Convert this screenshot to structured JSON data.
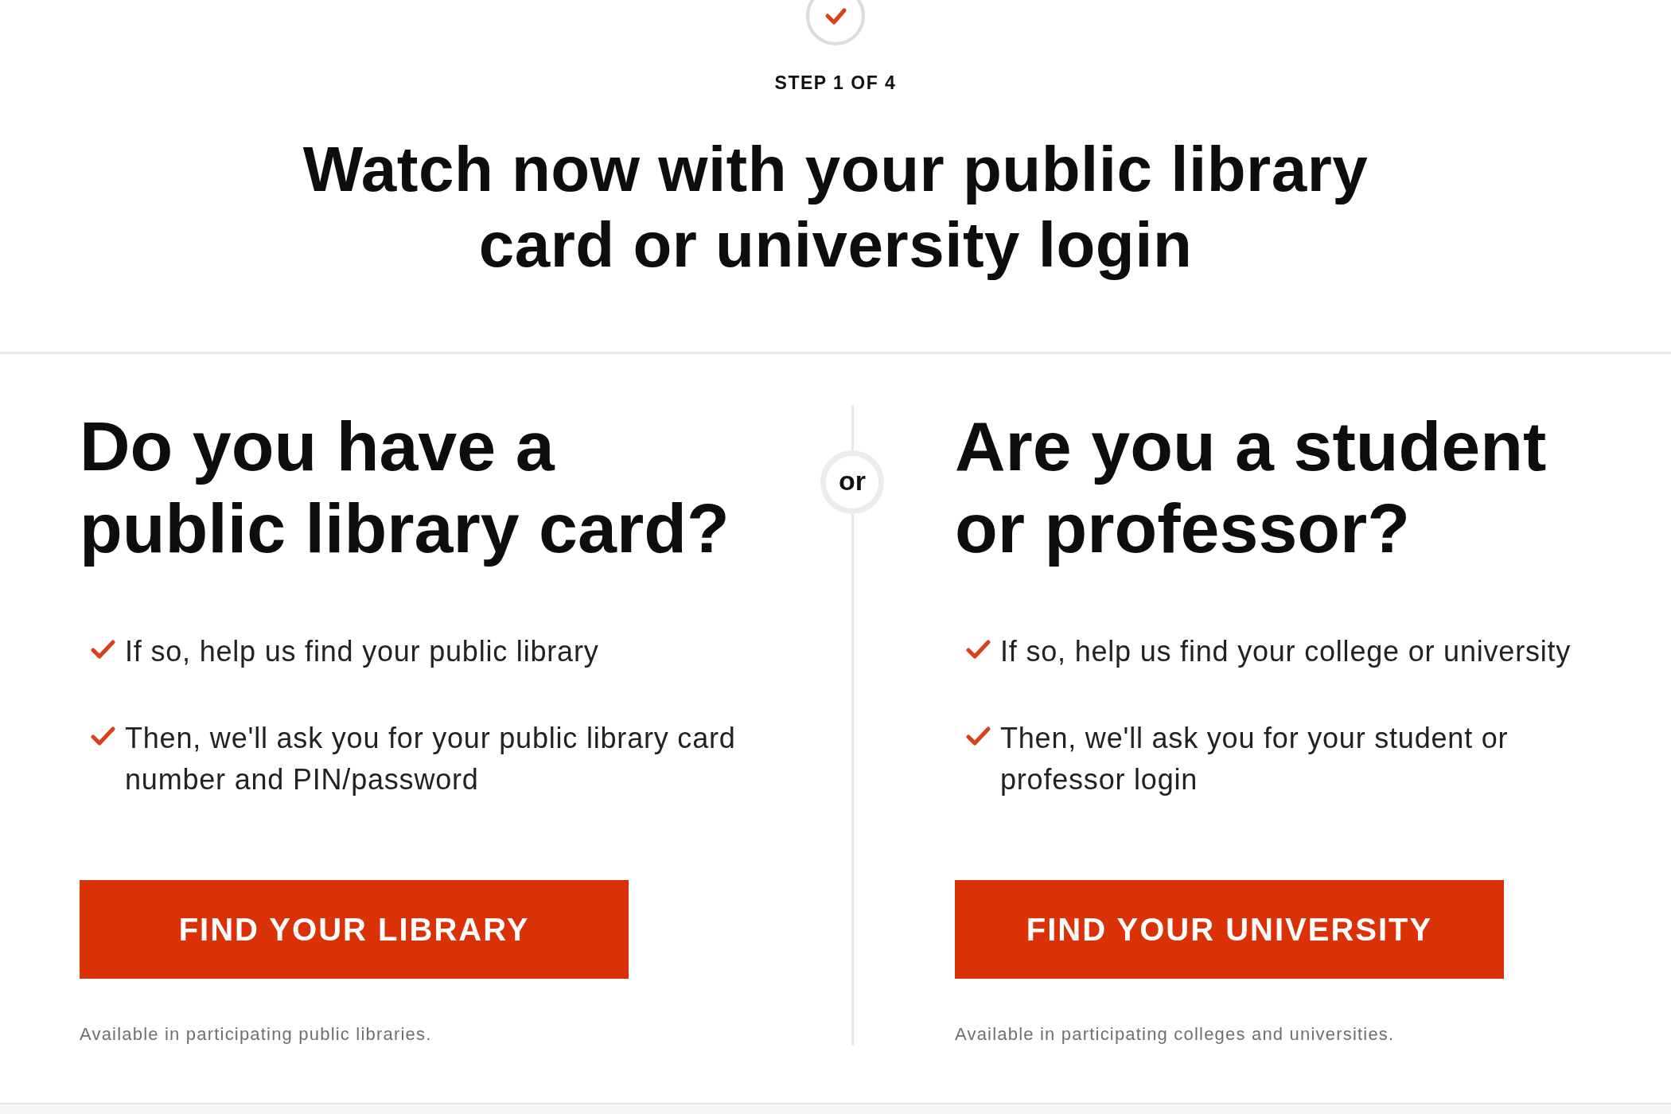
{
  "progress": {
    "label": "STEP 1 OF 4"
  },
  "title": "Watch now with your public library card or university login",
  "separator": "or",
  "options": [
    {
      "heading": "Do you have a public library card?",
      "points": [
        "If so, help us find your public library",
        "Then, we'll ask you for your public library card number and PIN/password"
      ],
      "button": "FIND YOUR LIBRARY",
      "note": "Available in participating public libraries."
    },
    {
      "heading": "Are you a student or professor?",
      "points": [
        "If so, help us find your college or university",
        "Then, we'll ask you for your student or professor login"
      ],
      "button": "FIND YOUR UNIVERSITY",
      "note": "Available in participating colleges and universities."
    }
  ]
}
